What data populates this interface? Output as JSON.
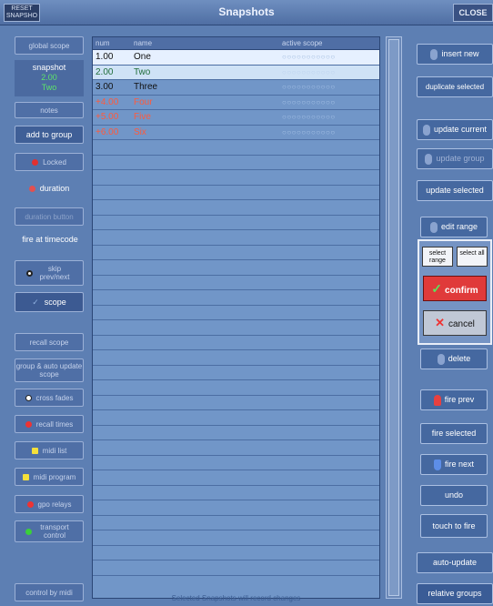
{
  "titlebar": {
    "reset_label": "RESET\nSNAPSHO",
    "title": "Snapshots",
    "close_label": "CLOSE"
  },
  "left": {
    "global_scope": "global scope",
    "snapshot_label": "snapshot",
    "current_num": "2.00",
    "current_name": "Two",
    "notes": "notes",
    "add_to_group": "add to group",
    "locked": "Locked",
    "duration": "duration",
    "duration_button": "duration button",
    "fire_at_timecode": "fire at timecode",
    "skip": "skip prev/next",
    "scope": "scope",
    "recall_scope": "recall scope",
    "group_auto_update": "group & auto update scope",
    "cross_fades": "cross fades",
    "recall_times": "recall times",
    "midi_list": "midi list",
    "midi_program": "midi program",
    "gpo_relays": "gpo relays",
    "transport_control": "transport control",
    "control_by_midi": "control by midi"
  },
  "table": {
    "headers": {
      "num": "num",
      "name": "name",
      "scope": "active scope"
    },
    "rows": [
      {
        "num": "1.00",
        "name": "One",
        "style": "sel1"
      },
      {
        "num": "2.00",
        "name": "Two",
        "style": "sel2"
      },
      {
        "num": "3.00",
        "name": "Three",
        "style": "plain"
      },
      {
        "num": "+4.00",
        "name": "Four",
        "style": "red"
      },
      {
        "num": "+5.00",
        "name": "Five",
        "style": "red"
      },
      {
        "num": "+6.00",
        "name": "Six",
        "style": "red"
      }
    ],
    "scope_dots": "○○○○○○○○○○○",
    "empty_rows": 29,
    "footer": "Selected Snapshots will record changes"
  },
  "right": {
    "insert_new": "insert new",
    "duplicate_selected": "duplicate selected",
    "update_current": "update current",
    "update_group": "update group",
    "update_selected": "update selected",
    "edit_range": "edit range",
    "select_range": "select range",
    "select_all": "select all",
    "confirm": "confirm",
    "cancel": "cancel",
    "delete": "delete",
    "fire_prev": "fire prev",
    "fire_selected": "fire selected",
    "fire_next": "fire next",
    "undo": "undo",
    "touch_to_fire": "touch to fire",
    "auto_update": "auto-update",
    "relative_groups": "relative groups"
  },
  "colors": {
    "background": "#5d7fb3",
    "selected_row": "#e6f0ff",
    "current_row": "#cfe2f6",
    "red_text": "#ff5a3c",
    "confirm": "#e03a3a",
    "current_green": "#5ee36a"
  }
}
